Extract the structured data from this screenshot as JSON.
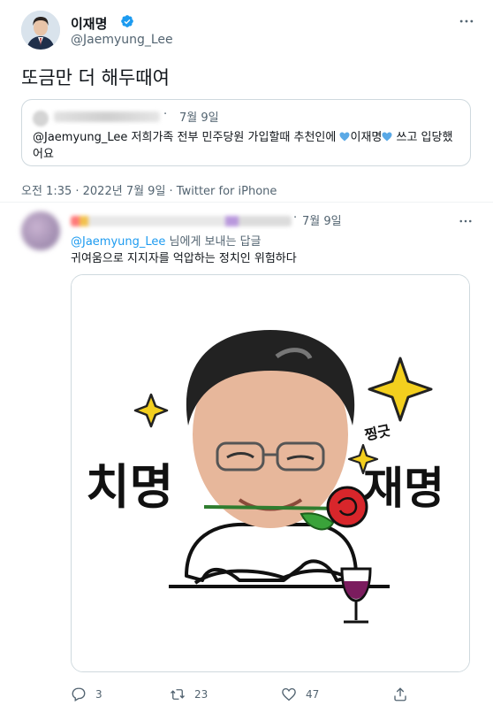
{
  "tweet": {
    "display_name": "이재명",
    "handle": "@Jaemyung_Lee",
    "text": "또금만 더 해두때여",
    "timestamp": "오전 1:35 · 2022년 7월 9일 · Twitter for iPhone"
  },
  "quote": {
    "date_sep": "·",
    "date": "7월 9일",
    "text_before": "@Jaemyung_Lee 저희가족 전부 민주당원 가입할때 추천인에 ",
    "text_mid": "이재명",
    "text_after": " 쓰고 입당했어요"
  },
  "reply": {
    "date_sep": "·",
    "date": "7월 9일",
    "reply_to_handle": "@Jaemyung_Lee",
    "reply_to_suffix": " 님에게 보내는 답글",
    "text": "귀여움으로 지지자를 억압하는 정치인 위험하다",
    "image_text": {
      "left": "치명",
      "right": "재명",
      "small": "찡긋"
    },
    "actions": {
      "reply_count": "3",
      "retweet_count": "23",
      "like_count": "47"
    }
  },
  "colors": {
    "accent": "#1d9bf0",
    "muted": "#536471",
    "border": "#cfd9de"
  }
}
